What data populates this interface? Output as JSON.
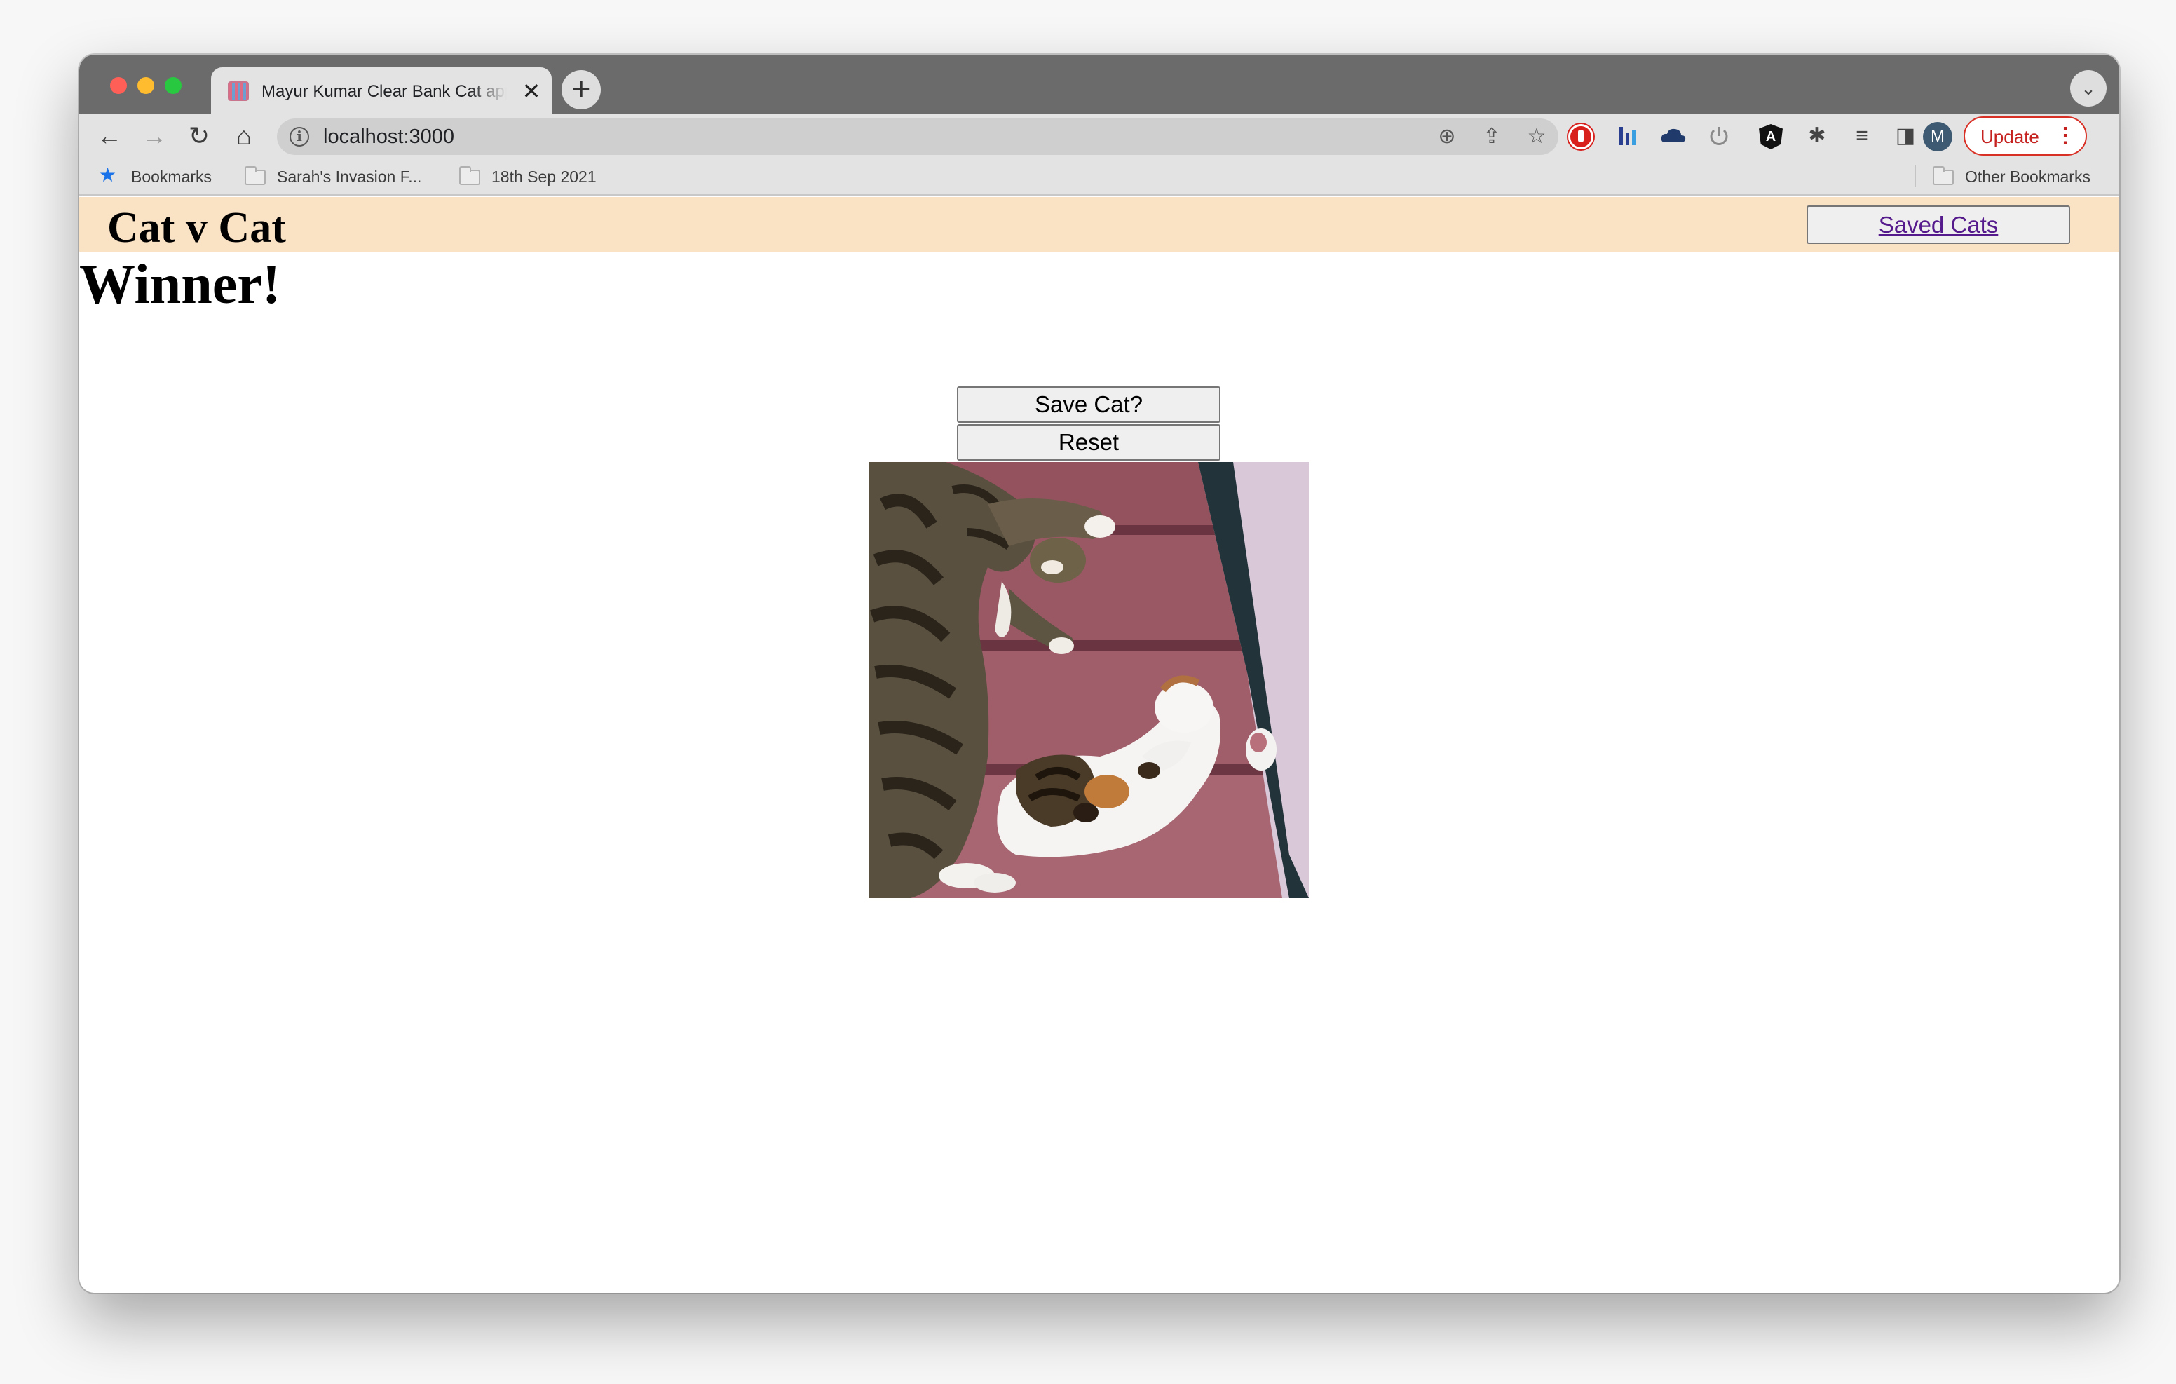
{
  "browser": {
    "tab": {
      "title": "Mayur Kumar Clear Bank Cat app",
      "close_glyph": "✕"
    },
    "new_tab_glyph": "+",
    "tab_list_glyph": "⌄",
    "nav": {
      "back": "←",
      "forward": "→",
      "reload": "↻",
      "home": "⌂"
    },
    "omnibox": {
      "url": "localhost:3000",
      "info_glyph": "i",
      "zoom_glyph": "⊕",
      "share_glyph": "⇪",
      "star_glyph": "☆"
    },
    "extensions": {
      "puzzle_glyph": "✱",
      "media_glyph": "≡",
      "sidepanel_glyph": "◨",
      "angular_glyph": "A"
    },
    "profile_initial": "M",
    "update": {
      "label": "Update",
      "menu_glyph": "⋮"
    }
  },
  "bookmarks_bar": {
    "star_glyph": "★",
    "items": [
      "Bookmarks",
      "Sarah's Invasion F...",
      "18th Sep 2021"
    ],
    "other": "Other Bookmarks"
  },
  "page": {
    "header": {
      "title": "Cat v Cat",
      "saved_cats_label": "Saved Cats",
      "background_color": "#fae2c4"
    },
    "result_heading": "Winner!",
    "buttons": {
      "save": "Save Cat?",
      "reset": "Reset"
    },
    "cat_image": {
      "description_icon": "cat-photo"
    }
  }
}
